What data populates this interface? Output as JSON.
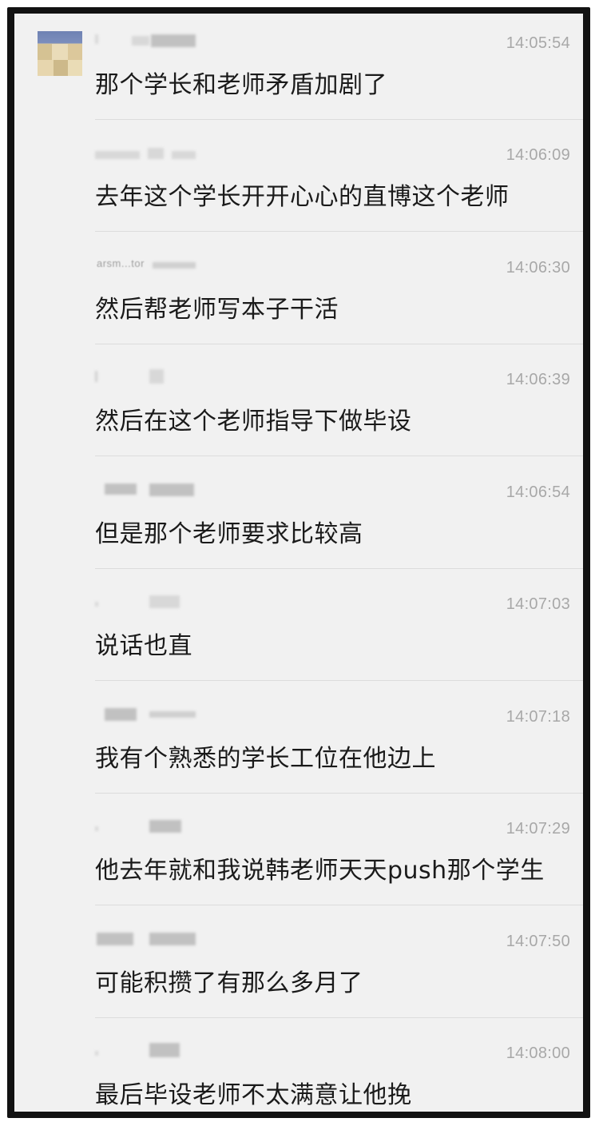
{
  "chat": {
    "messages": [
      {
        "time": "14:05:54",
        "text": "那个学长和老师矛盾加剧了"
      },
      {
        "time": "14:06:09",
        "text": "去年这个学长开开心心的直博这个老师"
      },
      {
        "time": "14:06:30",
        "text": "然后帮老师写本子干活",
        "sender_fragment": "arsm...tor"
      },
      {
        "time": "14:06:39",
        "text": "然后在这个老师指导下做毕设"
      },
      {
        "time": "14:06:54",
        "text": "但是那个老师要求比较高"
      },
      {
        "time": "14:07:03",
        "text": "说话也直"
      },
      {
        "time": "14:07:18",
        "text": "我有个熟悉的学长工位在他边上"
      },
      {
        "time": "14:07:29",
        "text": "他去年就和我说韩老师天天push那个学生"
      },
      {
        "time": "14:07:50",
        "text": "可能积攒了有那么多月了"
      },
      {
        "time": "14:08:00",
        "text": "最后毕设老师不太满意让他挽"
      }
    ]
  },
  "colors": {
    "background": "#f1f1f1",
    "frame": "#121212",
    "message_text": "#1a1a1a",
    "timestamp": "#a8a8a8",
    "divider": "#dcdcdc"
  }
}
